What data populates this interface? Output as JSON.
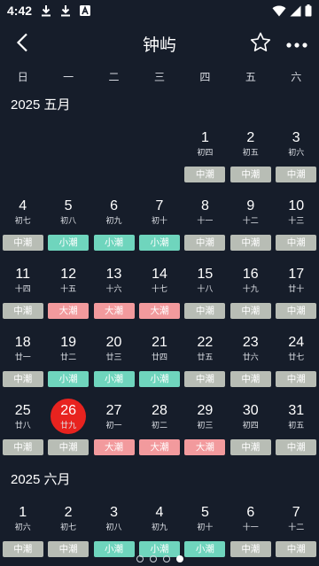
{
  "status": {
    "time": "4:42",
    "icons": [
      "download-icon",
      "download-icon",
      "a-badge-icon",
      "wifi-icon",
      "signal-icon",
      "battery-icon"
    ]
  },
  "header": {
    "title": "钟屿",
    "back_icon": "chevron-left-icon",
    "star_icon": "star-outline-icon",
    "more_icon": "more-horizontal-icon"
  },
  "weekdays": [
    "日",
    "一",
    "二",
    "三",
    "四",
    "五",
    "六"
  ],
  "colors": {
    "background": "#161d2a",
    "today": "#e8231f",
    "tide_mid": "#b8bdb5",
    "tide_small": "#6fd5bd",
    "tide_large": "#f29a9d"
  },
  "months": [
    {
      "title": "2025 五月",
      "weeks": [
        [
          null,
          null,
          null,
          null,
          {
            "day": "1",
            "lunar": "初四",
            "tide": "中潮",
            "type": "mid"
          },
          {
            "day": "2",
            "lunar": "初五",
            "tide": "中潮",
            "type": "mid"
          },
          {
            "day": "3",
            "lunar": "初六",
            "tide": "中潮",
            "type": "mid"
          }
        ],
        [
          {
            "day": "4",
            "lunar": "初七",
            "tide": "中潮",
            "type": "mid"
          },
          {
            "day": "5",
            "lunar": "初八",
            "tide": "小潮",
            "type": "small"
          },
          {
            "day": "6",
            "lunar": "初九",
            "tide": "小潮",
            "type": "small"
          },
          {
            "day": "7",
            "lunar": "初十",
            "tide": "小潮",
            "type": "small"
          },
          {
            "day": "8",
            "lunar": "十一",
            "tide": "中潮",
            "type": "mid"
          },
          {
            "day": "9",
            "lunar": "十二",
            "tide": "中潮",
            "type": "mid"
          },
          {
            "day": "10",
            "lunar": "十三",
            "tide": "中潮",
            "type": "mid"
          }
        ],
        [
          {
            "day": "11",
            "lunar": "十四",
            "tide": "中潮",
            "type": "mid"
          },
          {
            "day": "12",
            "lunar": "十五",
            "tide": "大潮",
            "type": "large"
          },
          {
            "day": "13",
            "lunar": "十六",
            "tide": "大潮",
            "type": "large"
          },
          {
            "day": "14",
            "lunar": "十七",
            "tide": "大潮",
            "type": "large"
          },
          {
            "day": "15",
            "lunar": "十八",
            "tide": "中潮",
            "type": "mid"
          },
          {
            "day": "16",
            "lunar": "十九",
            "tide": "中潮",
            "type": "mid"
          },
          {
            "day": "17",
            "lunar": "廿十",
            "tide": "中潮",
            "type": "mid"
          }
        ],
        [
          {
            "day": "18",
            "lunar": "廿一",
            "tide": "中潮",
            "type": "mid"
          },
          {
            "day": "19",
            "lunar": "廿二",
            "tide": "小潮",
            "type": "small"
          },
          {
            "day": "20",
            "lunar": "廿三",
            "tide": "小潮",
            "type": "small"
          },
          {
            "day": "21",
            "lunar": "廿四",
            "tide": "小潮",
            "type": "small"
          },
          {
            "day": "22",
            "lunar": "廿五",
            "tide": "中潮",
            "type": "mid"
          },
          {
            "day": "23",
            "lunar": "廿六",
            "tide": "中潮",
            "type": "mid"
          },
          {
            "day": "24",
            "lunar": "廿七",
            "tide": "中潮",
            "type": "mid"
          }
        ],
        [
          {
            "day": "25",
            "lunar": "廿八",
            "tide": "中潮",
            "type": "mid"
          },
          {
            "day": "26",
            "lunar": "廿九",
            "tide": "中潮",
            "type": "mid",
            "today": true
          },
          {
            "day": "27",
            "lunar": "初一",
            "tide": "大潮",
            "type": "large"
          },
          {
            "day": "28",
            "lunar": "初二",
            "tide": "大潮",
            "type": "large"
          },
          {
            "day": "29",
            "lunar": "初三",
            "tide": "大潮",
            "type": "large"
          },
          {
            "day": "30",
            "lunar": "初四",
            "tide": "中潮",
            "type": "mid"
          },
          {
            "day": "31",
            "lunar": "初五",
            "tide": "中潮",
            "type": "mid"
          }
        ]
      ]
    },
    {
      "title": "2025 六月",
      "weeks": [
        [
          {
            "day": "1",
            "lunar": "初六",
            "tide": "中潮",
            "type": "mid"
          },
          {
            "day": "2",
            "lunar": "初七",
            "tide": "中潮",
            "type": "mid"
          },
          {
            "day": "3",
            "lunar": "初八",
            "tide": "小潮",
            "type": "small"
          },
          {
            "day": "4",
            "lunar": "初九",
            "tide": "小潮",
            "type": "small"
          },
          {
            "day": "5",
            "lunar": "初十",
            "tide": "小潮",
            "type": "small"
          },
          {
            "day": "6",
            "lunar": "十一",
            "tide": "中潮",
            "type": "mid"
          },
          {
            "day": "7",
            "lunar": "十二",
            "tide": "中潮",
            "type": "mid"
          }
        ]
      ]
    }
  ],
  "pager": {
    "count": 4,
    "active": 3
  }
}
